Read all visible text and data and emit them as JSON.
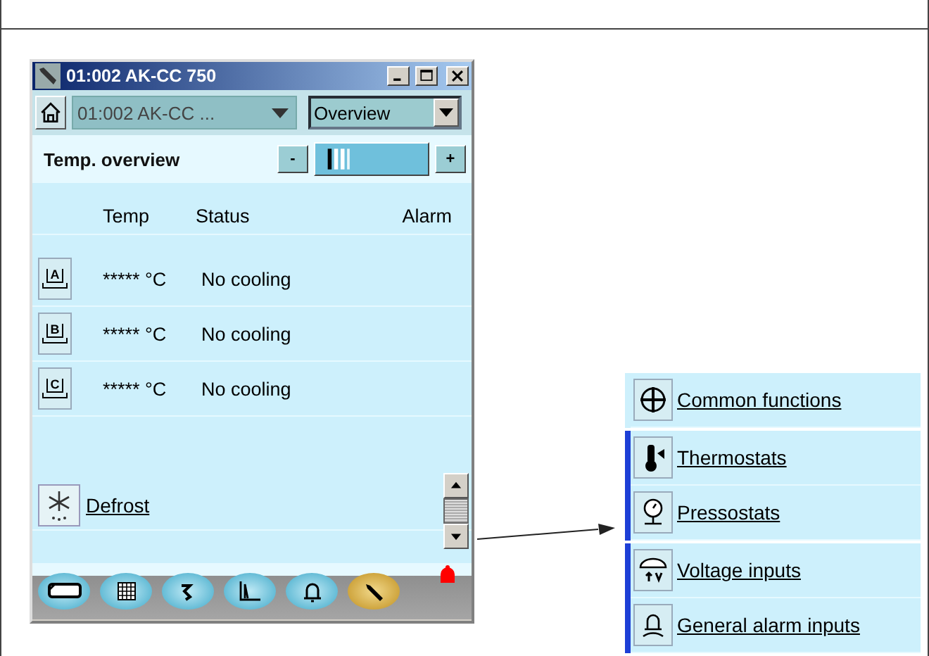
{
  "window": {
    "title": "01:002 AK-CC 750"
  },
  "device_select": {
    "value": "01:002 AK-CC ..."
  },
  "view_select": {
    "value": "Overview"
  },
  "section_title": "Temp. overview",
  "zoom": {
    "minus": "-",
    "plus": "+"
  },
  "columns": [
    "Temp",
    "Status",
    "Alarm"
  ],
  "rows": [
    {
      "badge": "A",
      "temp": "***** °C",
      "status": "No cooling"
    },
    {
      "badge": "B",
      "temp": "***** °C",
      "status": "No cooling"
    },
    {
      "badge": "C",
      "temp": "***** °C",
      "status": "No cooling"
    }
  ],
  "link": {
    "label": "Defrost"
  },
  "toolbar": [
    {
      "kind": "display",
      "selected": false
    },
    {
      "kind": "table",
      "selected": false
    },
    {
      "kind": "history",
      "selected": false
    },
    {
      "kind": "trend",
      "selected": false
    },
    {
      "kind": "alarm",
      "selected": false
    },
    {
      "kind": "service",
      "selected": true
    }
  ],
  "alarm_active": true,
  "menu": {
    "groups": [
      {
        "marked": false,
        "items": [
          {
            "kind": "common",
            "label": "Common functions"
          }
        ]
      },
      {
        "marked": true,
        "items": [
          {
            "kind": "thermostat",
            "label": "Thermostats"
          },
          {
            "kind": "pressostat",
            "label": "Pressostats"
          }
        ]
      },
      {
        "marked": true,
        "items": [
          {
            "kind": "voltage",
            "label": "Voltage inputs"
          },
          {
            "kind": "alarm",
            "label": "General alarm inputs"
          }
        ]
      }
    ]
  }
}
